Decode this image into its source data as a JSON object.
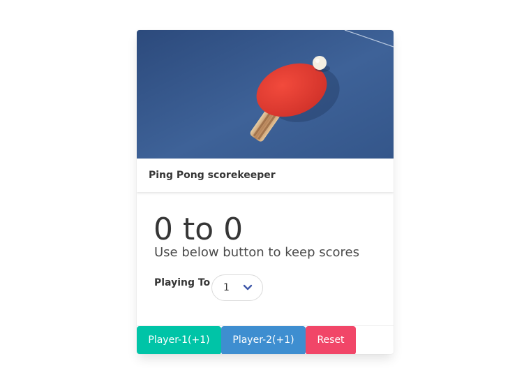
{
  "card": {
    "image_alt": "ping-pong-paddle-image",
    "header_title": "Ping Pong scorekeeper"
  },
  "scoreboard": {
    "player1_score": "0",
    "separator": "to",
    "player2_score": "0",
    "subtitle": "Use below button to keep scores"
  },
  "playing_to": {
    "label": "Playing To",
    "selected_value": "1"
  },
  "footer": {
    "player1_button": "Player-1(+1)",
    "player2_button": "Player-2(+1)",
    "reset_button": "Reset"
  },
  "colors": {
    "player1": "#00c4a7",
    "player2": "#3e8ed0",
    "reset": "#f14668",
    "table_blue": "#3c5f94"
  }
}
